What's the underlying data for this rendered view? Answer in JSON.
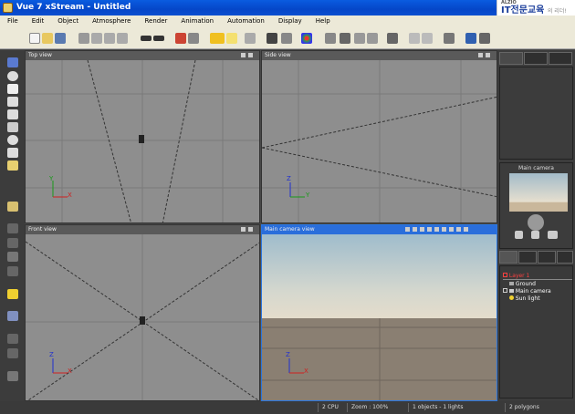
{
  "window": {
    "title": "Vue 7 xStream - Untitled"
  },
  "brand": {
    "top": "ALZIO",
    "main": "IT전문교육",
    "suffix": "의 리더!"
  },
  "menu": [
    "File",
    "Edit",
    "Object",
    "Atmosphere",
    "Render",
    "Animation",
    "Automation",
    "Display",
    "Help"
  ],
  "viewports": {
    "top": "Top view",
    "side": "Side view",
    "front": "Front view",
    "camera": "Main camera view"
  },
  "axes": {
    "x": "X",
    "y": "Y",
    "z": "Z"
  },
  "right_panel": {
    "camera_label": "Main camera",
    "layers": [
      {
        "label": "Layer 1",
        "color": "#ff4040"
      },
      {
        "label": "Ground",
        "color": "#ffffff"
      },
      {
        "label": "Main camera",
        "color": "#ffffff"
      },
      {
        "label": "Sun light",
        "color": "#ffffff"
      }
    ]
  },
  "status": {
    "cpu": "2 CPU",
    "zoom": "Zoom : 100%",
    "objects": "1 objects - 1 lights",
    "polygons": "2 polygons"
  }
}
